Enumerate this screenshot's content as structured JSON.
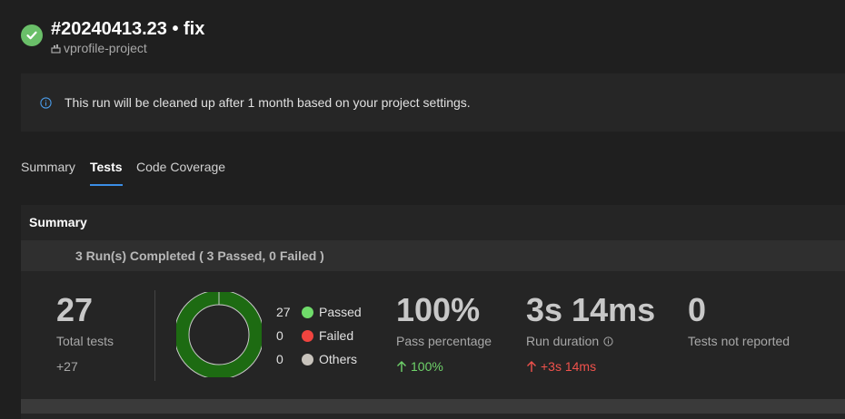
{
  "header": {
    "run_title": "#20240413.23 • fix",
    "project": "vprofile-project",
    "status": "succeeded"
  },
  "banner": {
    "text": "This run will be cleaned up after 1 month based on your project settings."
  },
  "tabs": [
    {
      "label": "Summary",
      "active": false
    },
    {
      "label": "Tests",
      "active": true
    },
    {
      "label": "Code Coverage",
      "active": false
    }
  ],
  "summary": {
    "title": "Summary",
    "runs_text": "3 Run(s) Completed ( 3 Passed, 0 Failed )",
    "total_tests": {
      "value": "27",
      "label": "Total tests",
      "delta": "+27"
    },
    "legend": [
      {
        "count": "27",
        "label": "Passed",
        "color": "#6fdb6a"
      },
      {
        "count": "0",
        "label": "Failed",
        "color": "#f0443f"
      },
      {
        "count": "0",
        "label": "Others",
        "color": "#c8c3bc"
      }
    ],
    "donut": {
      "passed": 27,
      "failed": 0,
      "others": 0,
      "ring_color": "#1d6b12"
    },
    "pass_percentage": {
      "value": "100%",
      "label": "Pass percentage",
      "delta": "100%",
      "delta_color": "#6fd36a"
    },
    "run_duration": {
      "value": "3s 14ms",
      "label": "Run duration",
      "delta": "+3s 14ms",
      "delta_color": "#f0524c"
    },
    "not_reported": {
      "value": "0",
      "label": "Tests not reported"
    }
  },
  "colors": {
    "accent": "#3b8ee6",
    "success": "#6abf69"
  }
}
